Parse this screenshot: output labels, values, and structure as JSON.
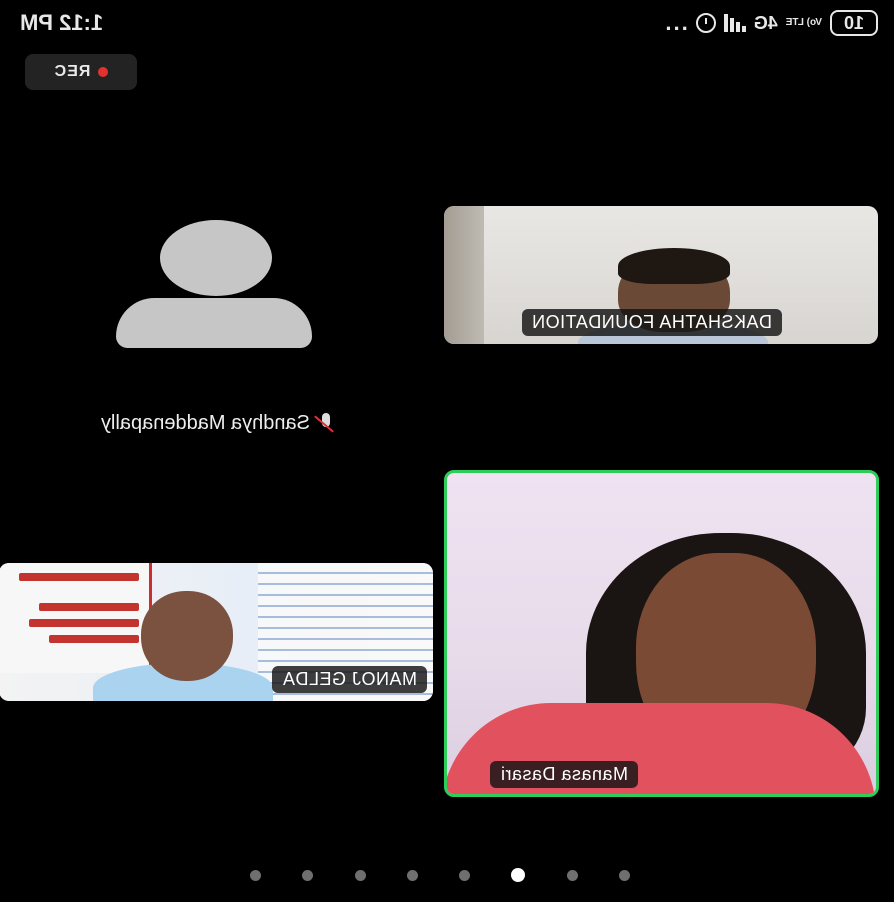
{
  "status_bar": {
    "battery": "10",
    "volte": "Vo) LTE",
    "network": "4G",
    "time": "1:12 PM",
    "more": "..."
  },
  "recording": {
    "label": "REC",
    "dot_color": "#e3312e"
  },
  "participants": [
    {
      "name": "DAKSHATHA FOUNDATION"
    },
    {
      "name": "Sandhya Maddenapally",
      "muted": true
    },
    {
      "name": "Manasa Dasari",
      "active_speaker": true,
      "highlight_color": "#2ecc5a"
    },
    {
      "name": "MANOJ GELDA"
    }
  ],
  "pagination": {
    "page_count": 8,
    "current_page": 6
  }
}
